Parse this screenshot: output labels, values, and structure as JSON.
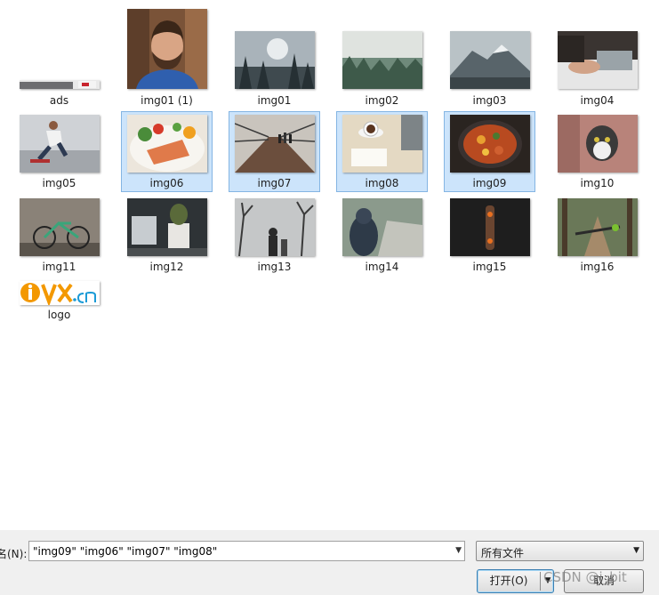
{
  "files": [
    {
      "name": "ads",
      "selected": false
    },
    {
      "name": "img01 (1)",
      "selected": false
    },
    {
      "name": "img01",
      "selected": false
    },
    {
      "name": "img02",
      "selected": false
    },
    {
      "name": "img03",
      "selected": false
    },
    {
      "name": "img04",
      "selected": false
    },
    {
      "name": "img05",
      "selected": false
    },
    {
      "name": "img06",
      "selected": true
    },
    {
      "name": "img07",
      "selected": true
    },
    {
      "name": "img08",
      "selected": true
    },
    {
      "name": "img09",
      "selected": true
    },
    {
      "name": "img10",
      "selected": false
    },
    {
      "name": "img11",
      "selected": false
    },
    {
      "name": "img12",
      "selected": false
    },
    {
      "name": "img13",
      "selected": false
    },
    {
      "name": "img14",
      "selected": false
    },
    {
      "name": "img15",
      "selected": false
    },
    {
      "name": "img16",
      "selected": false
    },
    {
      "name": "logo",
      "selected": false
    }
  ],
  "footer": {
    "filename_label": "名(N):",
    "filename_value": "\"img09\" \"img06\" \"img07\" \"img08\"",
    "filetype_value": "所有文件",
    "open_label": "打开(O)",
    "cancel_label": "取消",
    "watermark": "CSDN @i_bit"
  },
  "colors": {
    "selection_fill": "#cce4fb",
    "selection_border": "#84b5e3",
    "logo_orange": "#f39800"
  }
}
